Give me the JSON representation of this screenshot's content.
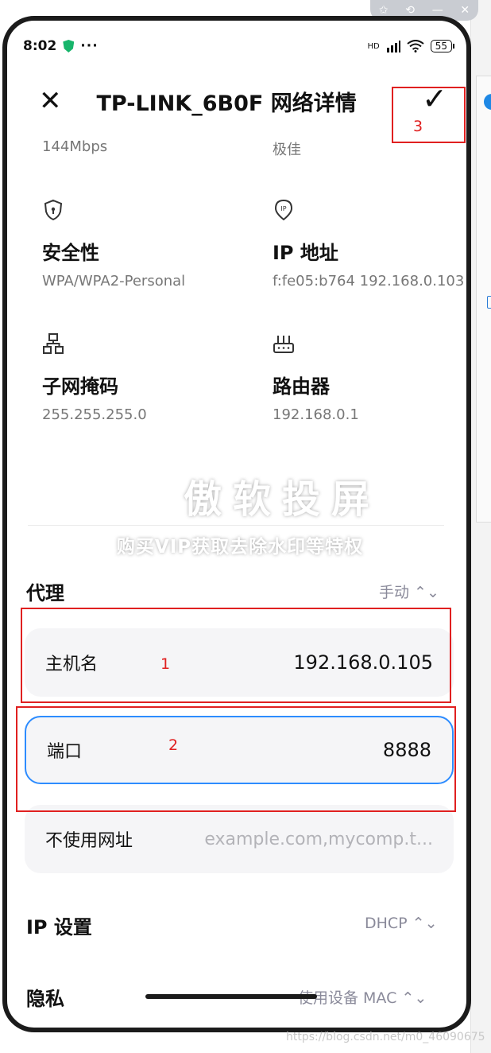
{
  "window_controls": {
    "pin": "✩",
    "restore": "⟲",
    "minimize": "—",
    "close": "✕"
  },
  "status_bar": {
    "time": "8:02",
    "more": "···",
    "network": "HD",
    "battery": "55"
  },
  "header": {
    "title": "TP-LINK_6B0F 网络详情"
  },
  "top_values": {
    "speed": "144Mbps",
    "signal": "极佳"
  },
  "details": {
    "security": {
      "title": "安全性",
      "value": "WPA/WPA2-Personal"
    },
    "ip": {
      "title": "IP 地址",
      "value": "f:fe05:b764 192.168.0.103"
    },
    "subnet": {
      "title": "子网掩码",
      "value": "255.255.255.0"
    },
    "router": {
      "title": "路由器",
      "value": "192.168.0.1"
    }
  },
  "watermark": {
    "big": "傲软投屏",
    "small": "购买VIP获取去除水印等特权"
  },
  "proxy": {
    "title": "代理",
    "mode": "手动 ⌃⌄"
  },
  "fields": {
    "hostname": {
      "label": "主机名",
      "value": "192.168.0.105"
    },
    "port": {
      "label": "端口",
      "value": "8888"
    },
    "bypass": {
      "label": "不使用网址",
      "placeholder": "example.com,mycomp.t..."
    }
  },
  "ip_settings": {
    "title": "IP 设置",
    "value": "DHCP ⌃⌄"
  },
  "privacy": {
    "title": "隐私",
    "value": "使用设备 MAC ⌃⌄"
  },
  "annotations": {
    "one": "1",
    "two": "2",
    "three": "3"
  },
  "footer": {
    "csdn": "https://blog.csdn.net/m0_46090675"
  },
  "colors": {
    "annotation_red": "#e02020",
    "focus_blue": "#2d8cff",
    "field_bg": "#f5f5f7"
  }
}
